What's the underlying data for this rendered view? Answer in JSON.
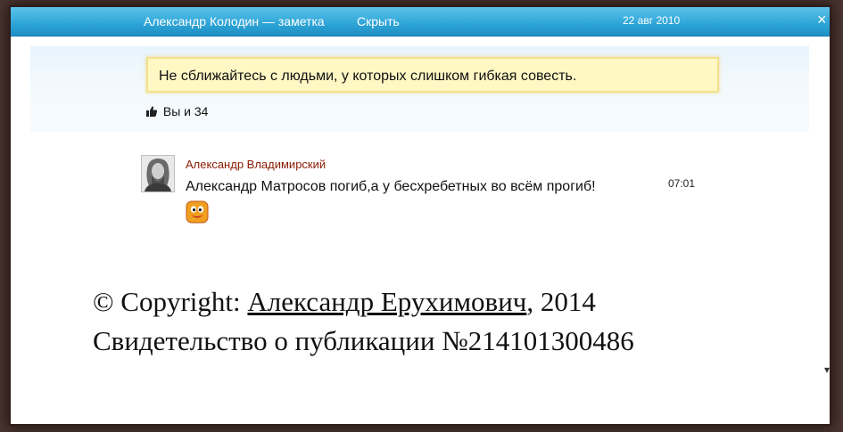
{
  "header": {
    "title": "Александр Колодин — заметка",
    "hide_label": "Скрыть",
    "date": "22 авг 2010",
    "close_glyph": "×"
  },
  "note": {
    "quote": "Не сближайтесь с людьми, у которых слишком гибкая совесть.",
    "likes": "Вы и 34"
  },
  "comment": {
    "author": "Александр Владимирский",
    "text": "Александр Матросов погиб,а у бесхребетных во всём прогиб!",
    "time": "07:01"
  },
  "footer": {
    "copyright_prefix": "© Copyright: ",
    "copyright_author": "Александр Ерухимович",
    "copyright_year": ", 2014",
    "certificate": "Свидетельство о публикации №214101300486"
  },
  "colors": {
    "header_blue": "#2da4d6",
    "quote_yellow": "#fff7c4",
    "author_red": "#8a1a00"
  },
  "icons": {
    "like": "thumbs-up-icon",
    "close": "close-icon",
    "smiley": "smiley-emoticon-icon",
    "avatar": "user-avatar"
  }
}
